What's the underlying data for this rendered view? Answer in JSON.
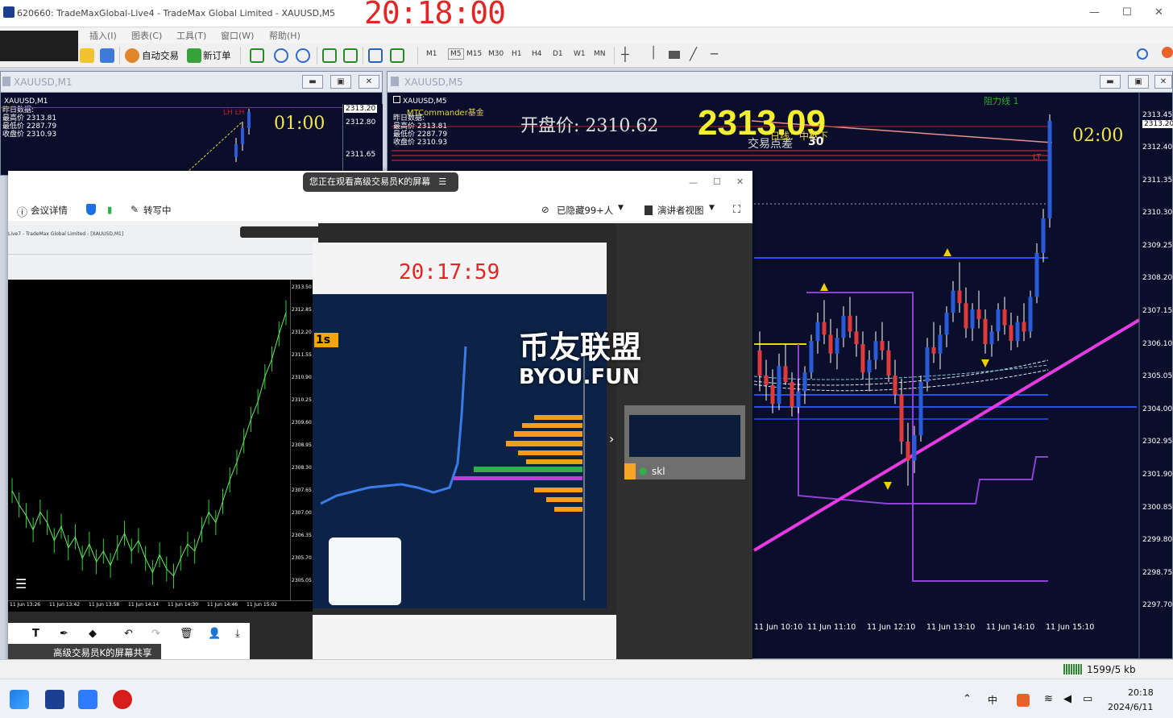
{
  "window": {
    "title": "620660: TradeMaxGlobal-Live4 - TradeMax Global Limited - XAUUSD,M5",
    "clock": "20:18:00",
    "min": "—",
    "max": "☐",
    "close": "✕"
  },
  "menu": [
    "插入(I)",
    "图表(C)",
    "工具(T)",
    "窗口(W)",
    "帮助(H)"
  ],
  "toolbar": {
    "auto_trade": "自动交易",
    "new_order": "新订单",
    "timeframes": [
      "M1",
      "M5",
      "M15",
      "M30",
      "H1",
      "H4",
      "D1",
      "W1",
      "MN"
    ]
  },
  "m1_window": {
    "title": "XAUUSD,M1",
    "symbol": "XAUUSD,M1",
    "info": [
      "昨日数据:",
      "最高价 2313.81",
      "最低价 2287.79",
      "收盘价 2310.93"
    ],
    "countdown": "01:00",
    "price_tag": "2313.20",
    "prices": [
      "2312.80",
      "2311.65"
    ],
    "lh_label": "LH LH"
  },
  "m5_window": {
    "title": "XAUUSD,M5",
    "symbol": "XAUUSD,M5",
    "commander": "MTCommander基金",
    "info": [
      "昨日数据:",
      "最高价 2313.81",
      "最低价 2287.79",
      "收盘价 2310.93"
    ],
    "open_label": "开盘价: 2310.62",
    "price_big": "2313.09",
    "spread_label": "交易点差",
    "spread_value": "30",
    "pivot_label": "日线：中枢下",
    "resistance": "阻力线 1",
    "countdown": "02:00",
    "lt": "LT",
    "price_axis": [
      "2313.45",
      "2313.20",
      "2312.40",
      "2311.35",
      "2310.30",
      "2309.25",
      "2308.20",
      "2307.15",
      "2306.10",
      "2305.05",
      "2304.00",
      "2302.95",
      "2301.90",
      "2300.85",
      "2299.80",
      "2298.75",
      "2297.70"
    ],
    "time_axis": [
      "11 Jun 10:10",
      "11 Jun 11:10",
      "11 Jun 12:10",
      "11 Jun 13:10",
      "11 Jun 14:10",
      "11 Jun 15:10"
    ],
    "chart_data": {
      "type": "candlestick",
      "ylim": [
        2297.7,
        2313.45
      ],
      "bid": 2313.2,
      "candles": [
        [
          2305.9,
          2306.5,
          2304.6,
          2305.1
        ],
        [
          2305.1,
          2305.6,
          2304.3,
          2304.8
        ],
        [
          2304.8,
          2305.3,
          2303.9,
          2304.2
        ],
        [
          2304.2,
          2305.8,
          2304.0,
          2305.4
        ],
        [
          2305.4,
          2306.1,
          2304.8,
          2304.9
        ],
        [
          2304.9,
          2305.2,
          2303.8,
          2304.1
        ],
        [
          2304.1,
          2305.0,
          2303.9,
          2304.6
        ],
        [
          2304.6,
          2305.4,
          2304.2,
          2305.2
        ],
        [
          2305.2,
          2306.4,
          2305.0,
          2306.2
        ],
        [
          2306.2,
          2307.1,
          2305.8,
          2306.8
        ],
        [
          2306.8,
          2307.5,
          2306.1,
          2306.4
        ],
        [
          2306.4,
          2306.9,
          2305.5,
          2305.8
        ],
        [
          2305.8,
          2306.6,
          2305.3,
          2306.3
        ],
        [
          2306.3,
          2307.3,
          2306.0,
          2307.0
        ],
        [
          2307.0,
          2307.6,
          2306.3,
          2306.5
        ],
        [
          2306.5,
          2307.0,
          2305.7,
          2306.1
        ],
        [
          2306.1,
          2306.5,
          2305.0,
          2305.2
        ],
        [
          2305.2,
          2305.9,
          2304.6,
          2305.6
        ],
        [
          2305.6,
          2306.5,
          2305.3,
          2306.2
        ],
        [
          2306.2,
          2306.8,
          2305.6,
          2305.9
        ],
        [
          2305.9,
          2306.2,
          2304.9,
          2305.1
        ],
        [
          2305.1,
          2305.6,
          2304.2,
          2304.5
        ],
        [
          2304.5,
          2305.0,
          2302.6,
          2303.0
        ],
        [
          2303.0,
          2303.6,
          2301.6,
          2302.4
        ],
        [
          2302.4,
          2303.5,
          2302.0,
          2303.2
        ],
        [
          2303.2,
          2305.1,
          2303.0,
          2304.9
        ],
        [
          2304.9,
          2306.3,
          2304.6,
          2306.0
        ],
        [
          2306.0,
          2306.8,
          2305.5,
          2305.8
        ],
        [
          2305.8,
          2306.7,
          2305.3,
          2306.4
        ],
        [
          2306.4,
          2307.3,
          2306.0,
          2307.1
        ],
        [
          2307.1,
          2308.1,
          2306.8,
          2307.8
        ],
        [
          2307.8,
          2308.7,
          2307.1,
          2307.4
        ],
        [
          2307.4,
          2307.9,
          2306.3,
          2306.6
        ],
        [
          2306.6,
          2307.4,
          2306.2,
          2307.2
        ],
        [
          2307.2,
          2307.8,
          2306.6,
          2306.9
        ],
        [
          2306.9,
          2307.2,
          2305.8,
          2306.1
        ],
        [
          2306.1,
          2306.7,
          2305.7,
          2306.5
        ],
        [
          2306.5,
          2307.4,
          2306.2,
          2307.2
        ],
        [
          2307.2,
          2307.6,
          2306.4,
          2306.7
        ],
        [
          2306.7,
          2307.1,
          2305.9,
          2306.2
        ],
        [
          2306.2,
          2307.0,
          2306.0,
          2306.8
        ],
        [
          2306.8,
          2307.4,
          2306.2,
          2306.5
        ],
        [
          2306.5,
          2307.8,
          2306.3,
          2307.6
        ],
        [
          2307.6,
          2309.3,
          2307.4,
          2309.0
        ],
        [
          2309.0,
          2310.4,
          2308.7,
          2310.1
        ],
        [
          2310.1,
          2313.4,
          2309.8,
          2313.2
        ]
      ]
    }
  },
  "meeting": {
    "banner": "您正在观看高级交易员K的屏幕",
    "details": "会议详情",
    "transcribe": "转写中",
    "hidden": "已隐藏99+人",
    "speaker_view": "演讲者视图",
    "participant": "skl",
    "share_label": "高级交易员K的屏幕共享"
  },
  "inner": {
    "clock": "20:17:59",
    "timer": "1s",
    "title": "Live7 - TradeMax Global Limited - [XAUUSD,M1]",
    "prices": [
      "2313.50",
      "2312.85",
      "2312.20",
      "2311.55",
      "2310.90",
      "2310.25",
      "2309.60",
      "2308.95",
      "2308.30",
      "2307.65",
      "2307.00",
      "2306.35",
      "2305.70",
      "2305.05"
    ],
    "times": [
      "11 Jun 13:26",
      "11 Jun 13:42",
      "11 Jun 13:58",
      "11 Jun 14:14",
      "11 Jun 14:30",
      "11 Jun 14:46",
      "11 Jun 15:02"
    ],
    "series": [
      2307.9,
      2307.5,
      2307.2,
      2306.8,
      2307.3,
      2307.0,
      2306.5,
      2306.9,
      2306.3,
      2306.6,
      2306.0,
      2306.4,
      2305.9,
      2306.2,
      2305.8,
      2306.3,
      2306.7,
      2306.2,
      2306.5,
      2306.0,
      2305.6,
      2306.1,
      2305.7,
      2305.5,
      2306.0,
      2306.4,
      2306.2,
      2306.8,
      2307.3,
      2307.0,
      2307.6,
      2308.2,
      2308.7,
      2309.3,
      2309.9,
      2310.4,
      2311.1,
      2311.6,
      2312.3,
      2312.9
    ]
  },
  "watermark": {
    "line1": "币友联盟",
    "line2": "BYOU.FUN"
  },
  "status": {
    "traffic": "1599/5 kb"
  },
  "taskbar": {
    "time": "20:18",
    "date": "2024/6/11",
    "ime": "中"
  }
}
